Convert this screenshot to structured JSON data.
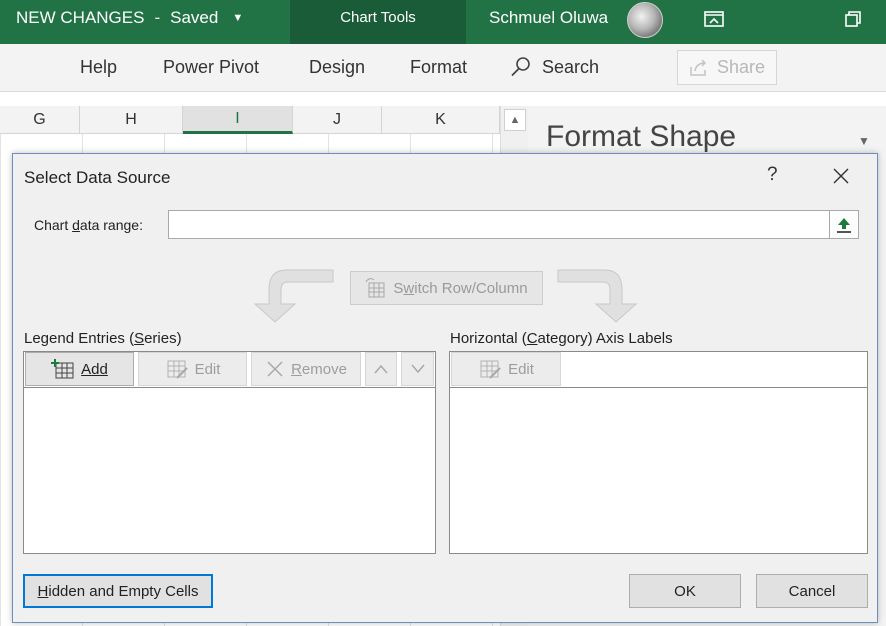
{
  "window": {
    "doc_title": "NEW CHANGES",
    "save_state": "Saved",
    "context_tab": "Chart Tools",
    "user_name": "Schmuel Oluwa"
  },
  "ribbon": {
    "tabs": [
      "Help",
      "Power Pivot",
      "Design",
      "Format"
    ],
    "search_label": "Search",
    "share_label": "Share"
  },
  "grid": {
    "columns": [
      "G",
      "H",
      "I",
      "J",
      "K"
    ],
    "selected_column": "I"
  },
  "format_pane": {
    "title": "Format Shape"
  },
  "dialog": {
    "title": "Select Data Source",
    "help": "?",
    "chart_range": {
      "label_pre": "Chart ",
      "label_key": "d",
      "label_post": "ata range:",
      "value": ""
    },
    "switch": {
      "pre": "S",
      "key": "w",
      "post": "itch Row/Column"
    },
    "legend": {
      "pre": "Legend Entries (",
      "key": "S",
      "post": "eries)",
      "add": "Add",
      "edit": "Edit",
      "remove_key": "R",
      "remove_post": "emove",
      "items": []
    },
    "axis": {
      "pre": "Horizontal (",
      "key": "C",
      "post": "ategory) Axis Labels",
      "edit": "Edit",
      "items": []
    },
    "hidden_cells": {
      "key": "H",
      "post": "idden and Empty Cells"
    },
    "ok": "OK",
    "cancel": "Cancel"
  },
  "colors": {
    "excel_green": "#217346",
    "context_green": "#1a5c38",
    "focus_blue": "#0078d7"
  }
}
